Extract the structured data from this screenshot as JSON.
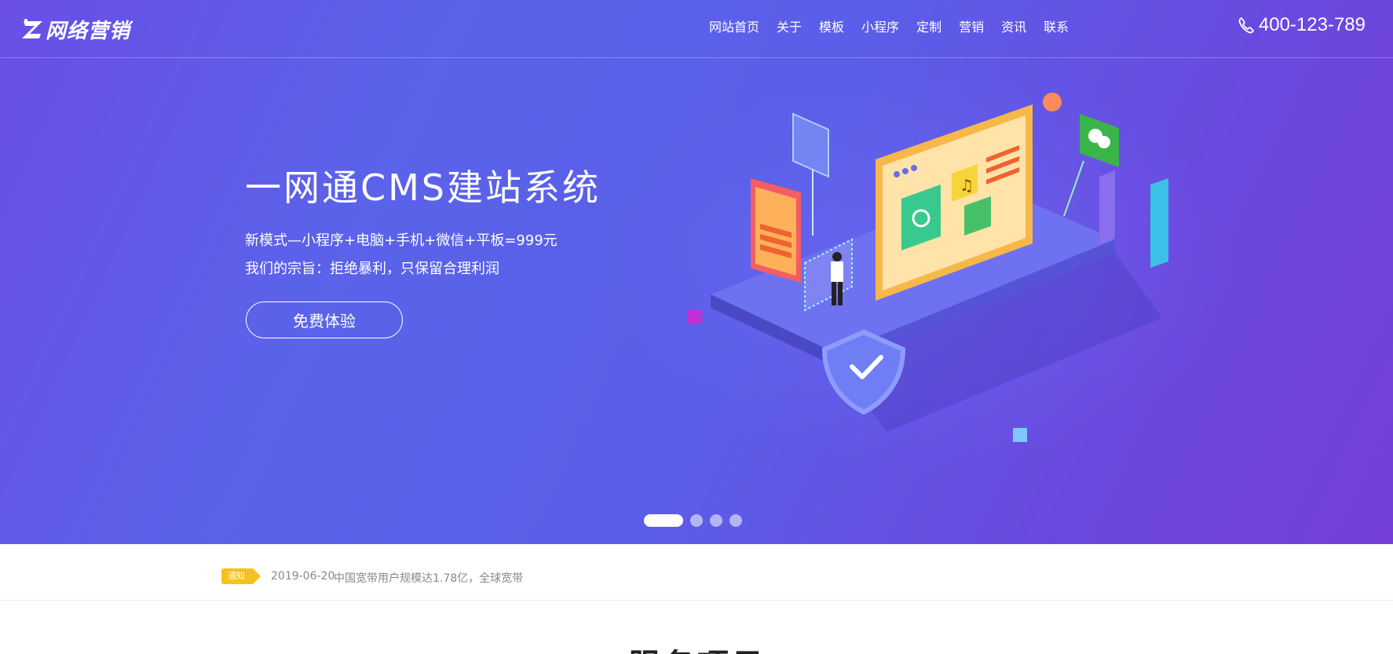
{
  "header": {
    "logo_text": "网络营销",
    "nav": [
      "网站首页",
      "关于",
      "模板",
      "小程序",
      "定制",
      "营销",
      "资讯",
      "联系"
    ],
    "phone": "400-123-789"
  },
  "hero": {
    "title": "一网通CMS建站系统",
    "line1": "新模式—小程序+电脑+手机+微信+平板=999元",
    "line2": "我们的宗旨：拒绝暴利，只保留合理利润",
    "cta": "免费体验",
    "slides": 4,
    "active_slide": 1
  },
  "notice": {
    "badge": "通知",
    "date": "2019-06-20",
    "text": "中国宽带用户规模达1.78亿，全球宽带"
  },
  "section": {
    "title": "服务项目"
  },
  "colors": {
    "hero_from": "#6a4ee6",
    "hero_to": "#7440d8",
    "notice_badge": "#f4c21d"
  }
}
